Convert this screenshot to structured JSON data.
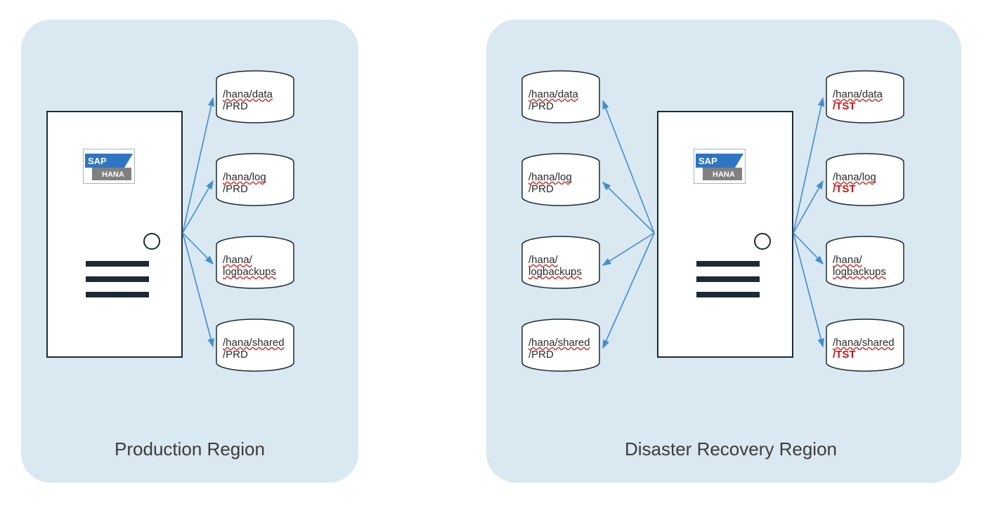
{
  "regions": {
    "prod": {
      "title": "Production Region"
    },
    "dr": {
      "title": "Disaster Recovery Region"
    }
  },
  "logo": {
    "brand": "SAP",
    "product": "HANA"
  },
  "disks": {
    "prod": {
      "data": {
        "line1": "/hana/data",
        "line2": "/PRD"
      },
      "log": {
        "line1": "/hana/log",
        "line2": "/PRD"
      },
      "logbackups": {
        "line1": "/hana/",
        "line2": "logbackups"
      },
      "shared": {
        "line1": "/hana/shared",
        "line2": "/PRD"
      }
    },
    "dr_left": {
      "data": {
        "line1": "/hana/data",
        "line2": "/PRD"
      },
      "log": {
        "line1": "/hana/log",
        "line2": "/PRD"
      },
      "logbackups": {
        "line1": "/hana/",
        "line2": "logbackups"
      },
      "shared": {
        "line1": "/hana/shared",
        "line2": "/PRD"
      }
    },
    "dr_right": {
      "data": {
        "line1": "/hana/data",
        "sid": "/TST"
      },
      "log": {
        "line1": "/hana/log",
        "sid": "/TST"
      },
      "logbackups": {
        "line1": "/hana/",
        "line2": "logbackups"
      },
      "shared": {
        "line1": "/hana/shared",
        "sid": "/TST"
      }
    }
  }
}
